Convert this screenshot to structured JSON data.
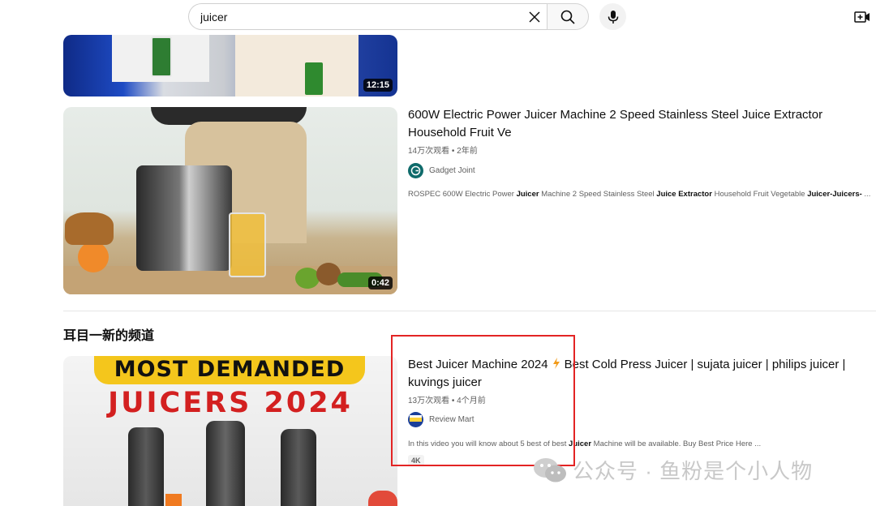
{
  "search": {
    "query": "juicer"
  },
  "icons": {
    "clear": "close-icon",
    "search": "search-icon",
    "mic": "microphone-icon",
    "create": "create-video-icon",
    "bolt": "lightning-bolt-icon",
    "watermark": "wechat-icon"
  },
  "videos": [
    {
      "duration": "12:15"
    },
    {
      "duration": "0:42",
      "title": "600W Electric Power Juicer Machine 2 Speed Stainless Steel Juice Extractor Household Fruit Ve",
      "meta": "14万次观看 • 2年前",
      "channel": "Gadget Joint",
      "desc": {
        "p1": "ROSPEC 600W Electric Power ",
        "b1": "Juicer",
        "p2": " Machine 2 Speed Stainless Steel ",
        "b2": "Juice Extractor",
        "p3": " Household Fruit Vegetable ",
        "b3": "Juicer-Juicers-",
        "p4": " ..."
      }
    },
    {
      "thumb_line1": "MOST DEMANDED",
      "thumb_line2": "JUICERS 2024",
      "title_a": "Best Juicer Machine 2024",
      "title_b": "Best Cold Press Juicer | sujata juicer | philips juicer | kuvings juicer",
      "meta": "13万次观看 • 4个月前",
      "channel": "Review Mart",
      "desc": {
        "p1": "In this video you will know about 5 best of best ",
        "b1": "Juicer",
        "p2": " Machine will be available. Buy Best Price Here  ..."
      },
      "badge": "4K"
    }
  ],
  "section_heading": "耳目一新的频道",
  "watermark_text": "公众号 · 鱼粉是个小人物",
  "colors": {
    "highlight": "#e32424",
    "bolt": "#f29b1a"
  }
}
